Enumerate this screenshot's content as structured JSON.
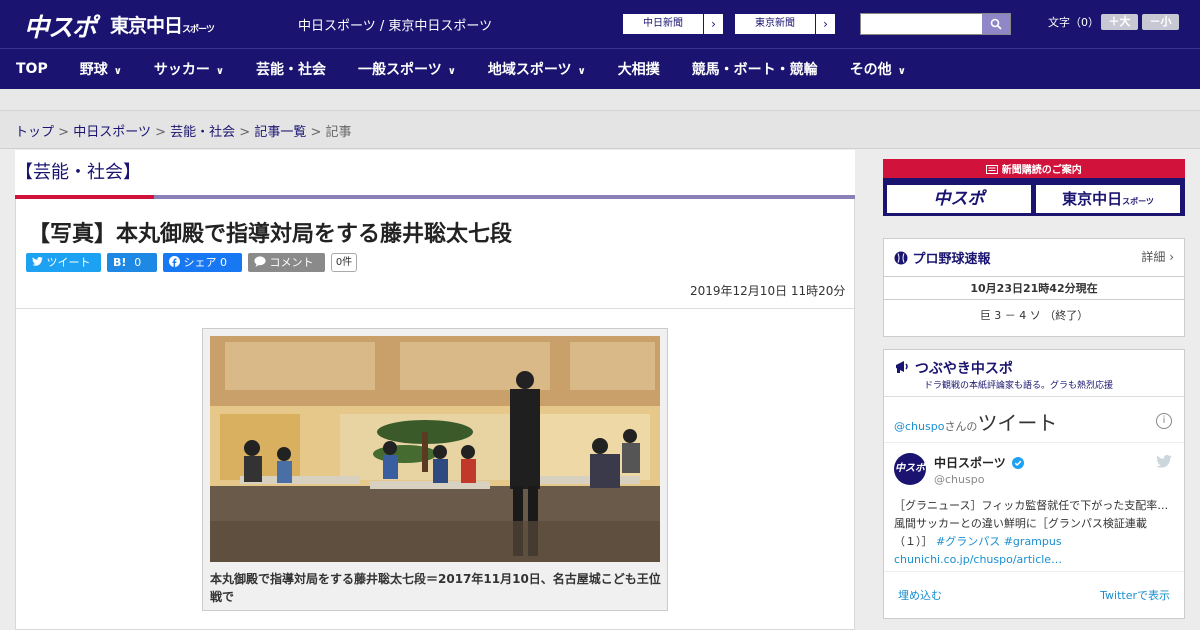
{
  "header": {
    "logo_main": "中スポ",
    "logo_tokyo": "東京中日",
    "logo_tokyo_small": "スポーツ",
    "site_name": "中日スポーツ / 東京中日スポーツ",
    "paper_links": [
      {
        "label": "中日新聞",
        "arrow": "›"
      },
      {
        "label": "東京新聞",
        "arrow": "›"
      }
    ],
    "search_placeholder": "",
    "font_size_label": "文字（0）",
    "font_larger": "＋大",
    "font_smaller": "－小"
  },
  "nav": {
    "items": [
      {
        "label": "TOP",
        "has_menu": false
      },
      {
        "label": "野球",
        "has_menu": true
      },
      {
        "label": "サッカー",
        "has_menu": true
      },
      {
        "label": "芸能・社会",
        "has_menu": false
      },
      {
        "label": "一般スポーツ",
        "has_menu": true
      },
      {
        "label": "地域スポーツ",
        "has_menu": true
      },
      {
        "label": "大相撲",
        "has_menu": false
      },
      {
        "label": "競馬・ボート・競輪",
        "has_menu": false
      },
      {
        "label": "その他",
        "has_menu": true
      }
    ]
  },
  "breadcrumb": {
    "items": [
      "トップ",
      "中日スポーツ",
      "芸能・社会",
      "記事一覧"
    ],
    "current": "記事",
    "separator": ">"
  },
  "article": {
    "category": "【芸能・社会】",
    "title": "【写真】本丸御殿で指導対局をする藤井聡太七段",
    "share": {
      "tweet": "ツイート",
      "hatena_label": "B!",
      "hatena_count": "0",
      "facebook": "シェア",
      "facebook_count": "0",
      "comment": "コメント",
      "comment_count": "0件"
    },
    "date": "2019年12月10日 11時20分",
    "photo_caption": "本丸御殿で指導対局をする藤井聡太七段＝2017年11月10日、名古屋城こども王位戦で"
  },
  "sidebar": {
    "subscription": {
      "heading": "新聞購読のご案内",
      "btn1": "中スポ",
      "btn2": "東京中日",
      "btn2_small": "スポーツ"
    },
    "baseball": {
      "title": "プロ野球速報",
      "detail": "詳細 ›",
      "time": "10月23日21時42分現在",
      "score": "巨 3 － 4 ソ （終了）"
    },
    "twitter": {
      "title": "つぶやき中スポ",
      "subtitle": "ドラ観戦の本紙評論家も語る。グラも熱烈応援",
      "handle_prefix": "@chuspo",
      "handle_suffix": "さんの",
      "tweet_word": "ツイート",
      "account_name": "中日スポーツ",
      "account_handle": "@chuspo",
      "avatar_text": "中スポ",
      "tweet_text": "［グラニュース］フィッカ監督就任で下がった支配率…風間サッカーとの違い鮮明に［グランパス検証連載（１）］",
      "hashtag1": "#グランパス",
      "hashtag2": "#grampus",
      "link": "chunichi.co.jp/chuspo/article…",
      "embed": "埋め込む",
      "view_on": "Twitterで表示"
    }
  },
  "colors": {
    "brand_navy": "#1a1470",
    "accent_red": "#d1123b",
    "twitter_blue": "#1da1f2",
    "facebook_blue": "#1877f2",
    "hatena_blue": "#1e88e5"
  }
}
